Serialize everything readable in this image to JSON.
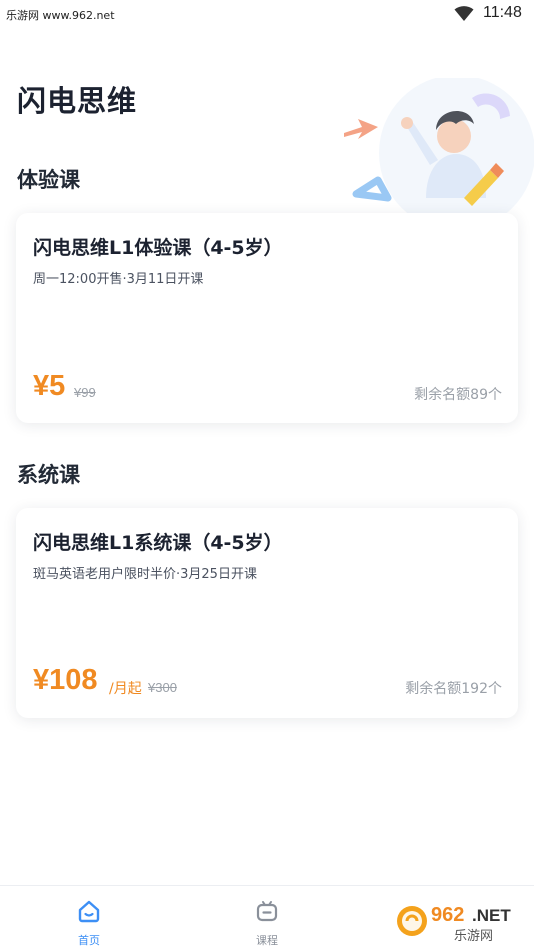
{
  "status_bar": {
    "watermark": "乐游网 www.962.net",
    "time": "11:48",
    "wifi_icon": "wifi-icon"
  },
  "page_title": "闪电思维",
  "sections": [
    {
      "title": "体验课",
      "course": {
        "title": "闪电思维L1体验课（4-5岁）",
        "subtitle": "周一12:00开售·3月11日开课",
        "price": "¥5",
        "price_unit": "",
        "old_price": "¥99",
        "quota": "剩余名额89个"
      }
    },
    {
      "title": "系统课",
      "course": {
        "title": "闪电思维L1系统课（4-5岁）",
        "subtitle": "斑马英语老用户限时半价·3月25日开课",
        "price": "¥108",
        "price_unit": "/月起",
        "old_price": "¥300",
        "quota": "剩余名额192个"
      }
    }
  ],
  "tab_bar": {
    "tabs": [
      {
        "label": "首页",
        "icon": "home-icon",
        "active": true
      },
      {
        "label": "课程",
        "icon": "course-icon",
        "active": false
      }
    ]
  },
  "watermark_badge": {
    "logo_text": "962.NET",
    "site_name": "乐游网"
  },
  "colors": {
    "accent": "#f08a22",
    "tab_active": "#3d8ff5",
    "tab_inactive": "#8a909a",
    "text_dark": "#1c2230"
  }
}
